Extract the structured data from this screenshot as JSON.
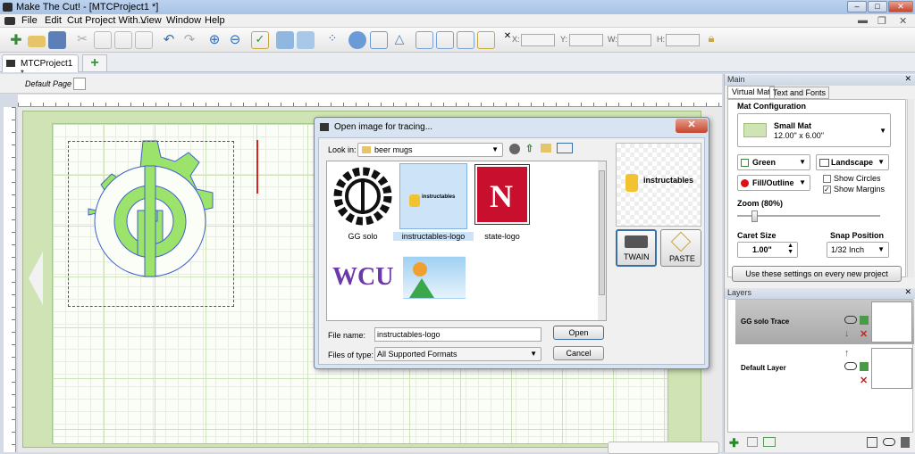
{
  "window": {
    "title": "Make The Cut! - [MTCProject1 *]"
  },
  "menu": [
    "File",
    "Edit",
    "Cut Project With...",
    "View",
    "Window",
    "Help"
  ],
  "toolbar": {
    "fields": [
      {
        "label": "X:"
      },
      {
        "label": "Y:"
      },
      {
        "label": "W:"
      },
      {
        "label": "H:"
      }
    ]
  },
  "tabs": {
    "project": "MTCProject1 *"
  },
  "page": {
    "name": "Default Page"
  },
  "panel": {
    "header": "Main",
    "tabs": [
      "Virtual Mat",
      "Text and Fonts"
    ],
    "mat_config_label": "Mat Configuration",
    "mat_name": "Small Mat",
    "mat_size": "12.00\" x 6.00\"",
    "color": "Green",
    "orientation": "Landscape",
    "fill": "Fill/Outline",
    "show_circles": "Show Circles",
    "show_margins": "Show Margins",
    "zoom_label": "Zoom (80%)",
    "caret_label": "Caret Size",
    "caret_value": "1.00\"",
    "snap_label": "Snap Position",
    "snap_value": "1/32 Inch",
    "use_settings": "Use these settings on every new project"
  },
  "layers": {
    "header": "Layers",
    "items": [
      {
        "name": "GG solo Trace"
      },
      {
        "name": "Default Layer"
      }
    ]
  },
  "dialog": {
    "title": "Open image for tracing...",
    "look_in_label": "Look in:",
    "look_in_value": "beer mugs",
    "files": [
      {
        "name": "GG solo"
      },
      {
        "name": "instructables-logo",
        "selected": true
      },
      {
        "name": "state-logo"
      },
      {
        "name": ""
      },
      {
        "name": ""
      }
    ],
    "preview_text": "instructables",
    "file_name_label": "File name:",
    "file_name_value": "instructables-logo",
    "file_type_label": "Files of type:",
    "file_type_value": "All Supported Formats",
    "open": "Open",
    "cancel": "Cancel",
    "twain": "TWAIN",
    "paste": "PASTE"
  },
  "colors": {
    "accent": "#3a6ea5",
    "mat": "#cfe3b4",
    "shape": "#9be36b",
    "outline": "#4060d0"
  }
}
